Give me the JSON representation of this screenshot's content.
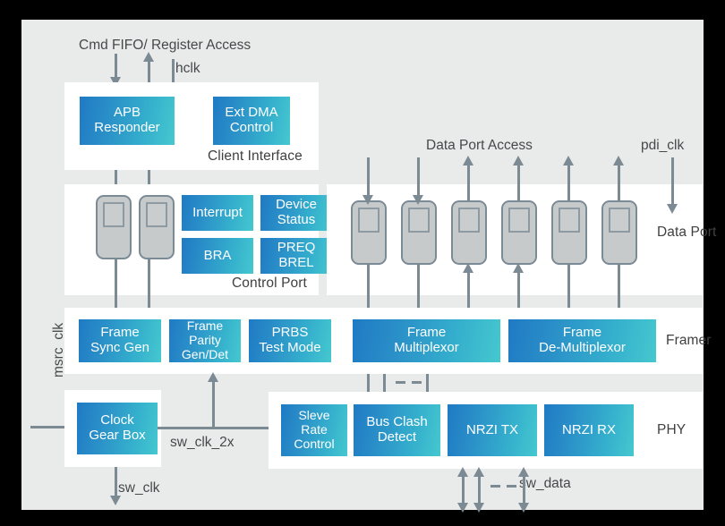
{
  "diagram": {
    "title": "Cmd FIFO/ Register Access",
    "background": "#e9eaea",
    "frame_color": "#000000",
    "accent_gradient_from": "#1f7ac4",
    "accent_gradient_to": "#45c8cf",
    "connector_color": "#7c8a93",
    "fifo_fill": "#c6cacb",
    "fifo_stroke": "#7b8b95"
  },
  "signals": {
    "cmd_fifo": "Cmd FIFO/ Register Access",
    "hclk": "hclk",
    "data_port_access": "Data Port Access",
    "pdi_clk": "pdi_clk",
    "msrc_clk": "msrc_clk",
    "sw_clk": "sw_clk",
    "sw_clk_2x": "sw_clk_2x",
    "sw_data": "sw_data"
  },
  "panels": {
    "client_interface": {
      "label": "Client Interface",
      "blocks": [
        {
          "id": "apb-responder",
          "lines": [
            "APB",
            "Responder"
          ]
        },
        {
          "id": "ext-dma-control",
          "lines": [
            "Ext DMA",
            "Control"
          ]
        }
      ]
    },
    "control_port": {
      "label": "Control Port",
      "fifo_count": 2,
      "blocks": [
        {
          "id": "interrupt",
          "lines": [
            "Interrupt"
          ]
        },
        {
          "id": "device-status",
          "lines": [
            "Device",
            "Status"
          ]
        },
        {
          "id": "bra",
          "lines": [
            "BRA"
          ]
        },
        {
          "id": "preq-brel",
          "lines": [
            "PREQ",
            "BREL"
          ]
        }
      ]
    },
    "data_port": {
      "label": "Data Port",
      "fifo_count": 6,
      "blocks": []
    },
    "framer": {
      "label": "Framer",
      "blocks": [
        {
          "id": "frame-sync-gen",
          "lines": [
            "Frame",
            "Sync Gen"
          ]
        },
        {
          "id": "frame-parity-gen-det",
          "lines": [
            "Frame",
            "Parity",
            "Gen/Det"
          ]
        },
        {
          "id": "prbs-test-mode",
          "lines": [
            "PRBS",
            "Test Mode"
          ]
        },
        {
          "id": "frame-multiplexor",
          "lines": [
            "Frame",
            "Multiplexor"
          ]
        },
        {
          "id": "frame-de-multiplexor",
          "lines": [
            "Frame",
            "De-Multiplexor"
          ]
        }
      ]
    },
    "clock": {
      "label": "",
      "blocks": [
        {
          "id": "clock-gear-box",
          "lines": [
            "Clock",
            "Gear Box"
          ]
        }
      ]
    },
    "phy": {
      "label": "PHY",
      "blocks": [
        {
          "id": "sleve-rate-control",
          "lines": [
            "Sleve",
            "Rate",
            "Control"
          ]
        },
        {
          "id": "bus-clash-detect",
          "lines": [
            "Bus Clash",
            "Detect"
          ]
        },
        {
          "id": "nrzi-tx",
          "lines": [
            "NRZI TX"
          ]
        },
        {
          "id": "nrzi-rx",
          "lines": [
            "NRZI RX"
          ]
        }
      ]
    }
  }
}
